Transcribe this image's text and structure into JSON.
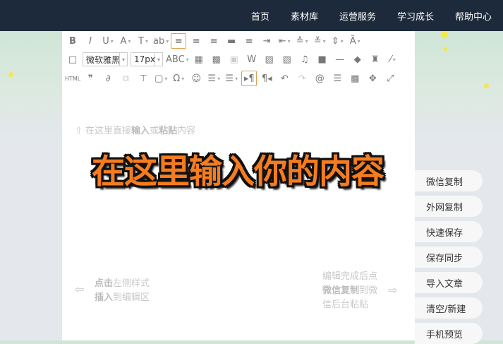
{
  "nav": [
    "首页",
    "素材库",
    "运营服务",
    "学习成长",
    "帮助中心"
  ],
  "toolbar": {
    "row1": [
      {
        "n": "bold",
        "g": "B"
      },
      {
        "n": "italic",
        "g": "I"
      },
      {
        "n": "underline",
        "g": "U",
        "d": 1
      },
      {
        "n": "font-color",
        "g": "A",
        "d": 1
      },
      {
        "n": "font-style",
        "g": "T",
        "d": 1
      },
      {
        "n": "background-color",
        "g": "ab",
        "d": 1
      },
      {
        "n": "align-left",
        "g": "≡",
        "a": 1
      },
      {
        "n": "align-center",
        "g": "≡"
      },
      {
        "n": "align-right",
        "g": "≡"
      },
      {
        "n": "align-justify-top",
        "g": "▬"
      },
      {
        "n": "align-justify",
        "g": "≡"
      },
      {
        "n": "indent",
        "g": "⇥"
      },
      {
        "n": "outdent",
        "g": "⇤",
        "d": 1
      },
      {
        "n": "paragraph-spacing-top",
        "g": "≙",
        "d": 1
      },
      {
        "n": "paragraph-spacing-bottom",
        "g": "≚",
        "d": 1
      },
      {
        "n": "line-height",
        "g": "⇕",
        "d": 1
      },
      {
        "n": "letter-spacing",
        "g": "Ä",
        "d": 1
      }
    ],
    "font_family": "微软雅黑",
    "font_size": "17px",
    "row2": [
      {
        "n": "strikethrough",
        "g": "ABC",
        "d": 1
      },
      {
        "n": "table",
        "g": "▦"
      },
      {
        "n": "table-image",
        "g": "▩"
      },
      {
        "n": "word-image",
        "g": "▣",
        "dim": 1
      },
      {
        "n": "word-import",
        "g": "W"
      },
      {
        "n": "image",
        "g": "▨"
      },
      {
        "n": "multi-image",
        "g": "▧"
      },
      {
        "n": "music",
        "g": "♫"
      },
      {
        "n": "video",
        "g": "■"
      },
      {
        "n": "horizontal-rule",
        "g": "—"
      },
      {
        "n": "eraser",
        "g": "◆"
      },
      {
        "n": "format-brush",
        "g": "♜"
      },
      {
        "n": "magic-wand",
        "g": "⁄",
        "d": 1
      }
    ],
    "row3": [
      {
        "n": "html",
        "g": "HTML"
      },
      {
        "n": "quote",
        "g": "❞"
      },
      {
        "n": "link",
        "g": "∂"
      },
      {
        "n": "unlink",
        "g": "⧉",
        "dim": 1
      },
      {
        "n": "template",
        "g": "⊤"
      },
      {
        "n": "search-replace",
        "g": "▢",
        "d": 1
      },
      {
        "n": "special-chars",
        "g": "Ω",
        "d": 1
      },
      {
        "n": "emoji",
        "g": "☺"
      },
      {
        "n": "ordered-list",
        "g": "☰",
        "d": 1
      },
      {
        "n": "unordered-list",
        "g": "☰",
        "d": 1
      },
      {
        "n": "ltr",
        "g": "▸¶",
        "a": 1
      },
      {
        "n": "rtl",
        "g": "¶◂"
      },
      {
        "n": "undo",
        "g": "↶"
      },
      {
        "n": "redo",
        "g": "↷",
        "dim": 1
      },
      {
        "n": "at-search",
        "g": "@"
      },
      {
        "n": "paragraph-format",
        "g": "☰"
      },
      {
        "n": "qrcode",
        "g": "▩"
      },
      {
        "n": "move",
        "g": "✥"
      },
      {
        "n": "fullscreen",
        "g": "⤢"
      }
    ],
    "new_doc_icon": "□"
  },
  "hints": {
    "top_pre": "在这里直接",
    "top_b1": "输入",
    "top_mid": "或",
    "top_b2": "粘贴",
    "top_post": "内容",
    "left_b1": "点击",
    "left_t1": "左侧样式",
    "left_b2": "插入",
    "left_t2": "到编辑区",
    "right_l1": "编辑完成后点",
    "right_b": "微信复制",
    "right_t": "到微",
    "right_l3": "信后台粘贴"
  },
  "headline": "在这里输入你的内容",
  "side_buttons": [
    "微信复制",
    "外网复制",
    "快速保存",
    "保存同步",
    "导入文章",
    "清空/新建",
    "手机预览"
  ]
}
